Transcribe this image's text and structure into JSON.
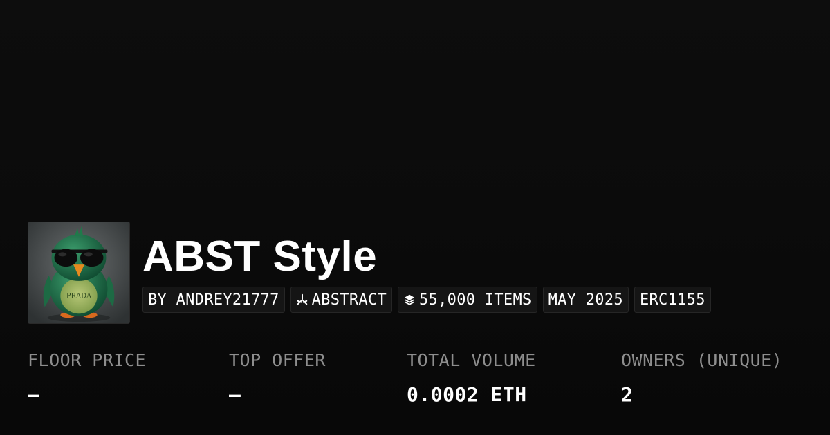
{
  "collection": {
    "title": "ABST Style",
    "avatar_label": "PRADA",
    "avatar_icon": "penguin-with-sunglasses"
  },
  "chips": {
    "creator": "BY ANDREY21777",
    "chain": "ABSTRACT",
    "chain_icon": "abstract-logo-icon",
    "items": "55,000 ITEMS",
    "items_icon": "layers-icon",
    "date": "MAY 2025",
    "standard": "ERC1155"
  },
  "stats": {
    "floor_price": {
      "label": "FLOOR PRICE",
      "value": "–"
    },
    "top_offer": {
      "label": "TOP OFFER",
      "value": "–"
    },
    "total_volume": {
      "label": "TOTAL VOLUME",
      "value": "0.0002 ETH"
    },
    "owners": {
      "label": "OWNERS (UNIQUE)",
      "value": "2"
    }
  },
  "colors": {
    "background": "#0a0a0a",
    "chip_background": "#151515",
    "label_gray": "#8e8e8e",
    "text": "#ffffff"
  }
}
